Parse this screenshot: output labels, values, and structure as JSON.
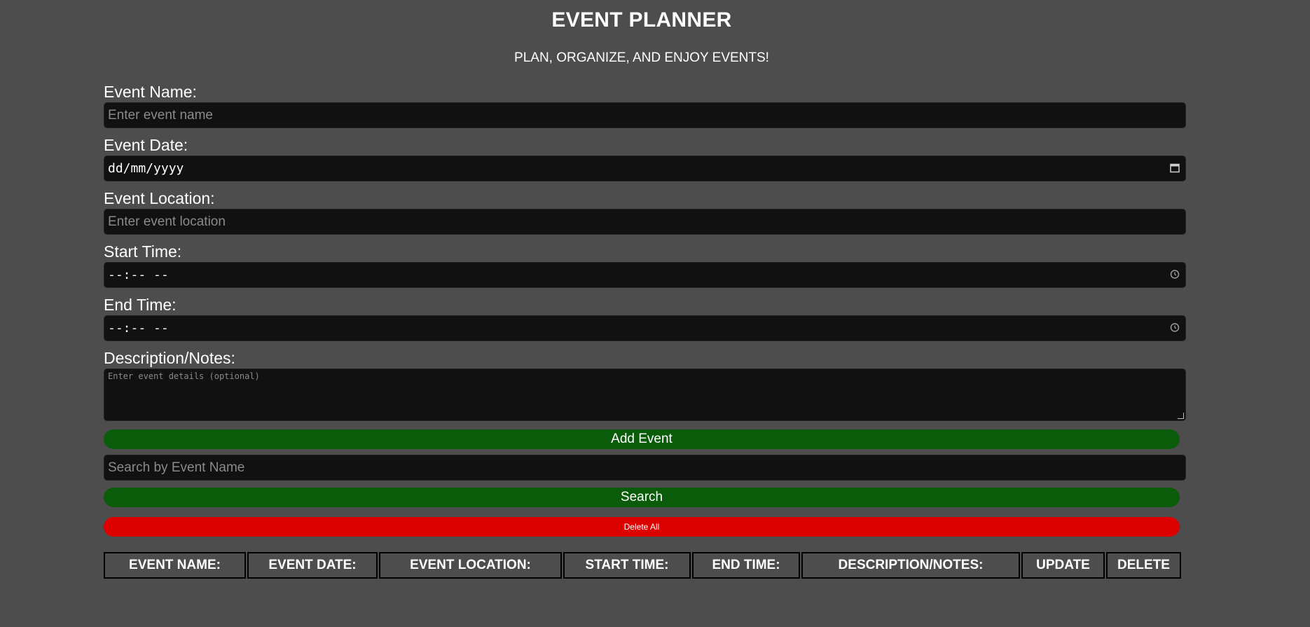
{
  "header": {
    "title": "EVENT PLANNER",
    "subtitle": "PLAN, ORGANIZE, AND ENJOY EVENTS!"
  },
  "form": {
    "event_name": {
      "label": "Event Name:",
      "placeholder": "Enter event name"
    },
    "event_date": {
      "label": "Event Date:",
      "value": "dd/mm/yyyy"
    },
    "event_location": {
      "label": "Event Location:",
      "placeholder": "Enter event location"
    },
    "start_time": {
      "label": "Start Time:",
      "value": "--:-- --"
    },
    "end_time": {
      "label": "End Time:",
      "value": "--:-- --"
    },
    "description": {
      "label": "Description/Notes:",
      "placeholder": "Enter event details (optional)"
    },
    "add_button": "Add Event"
  },
  "search": {
    "placeholder": "Search by Event Name",
    "button": "Search"
  },
  "delete_all_button": "Delete All",
  "table": {
    "headers": [
      "EVENT NAME:",
      "EVENT DATE:",
      "EVENT LOCATION:",
      "START TIME:",
      "END TIME:",
      "DESCRIPTION/NOTES:",
      "UPDATE",
      "DELETE"
    ]
  },
  "icons": {
    "calendar": "calendar-icon",
    "clock": "clock-icon"
  },
  "colors": {
    "background": "#4d4d4d",
    "input_background": "#111111",
    "primary_button": "#0a5c0a",
    "danger_button": "#dd0000"
  }
}
